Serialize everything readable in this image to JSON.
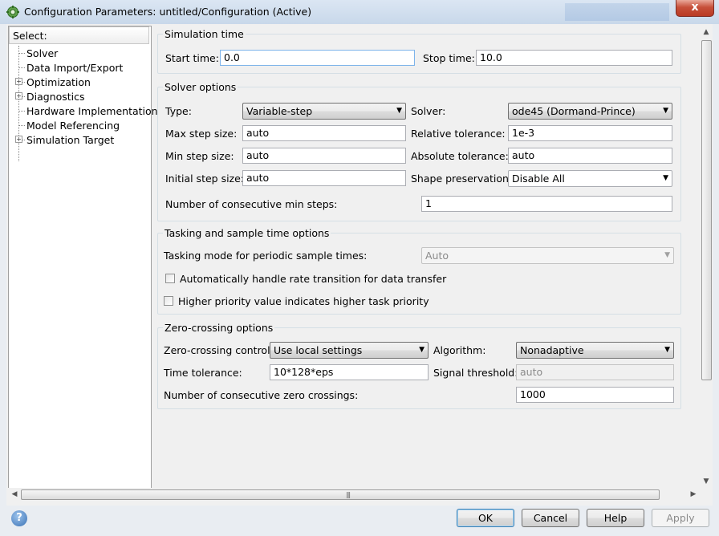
{
  "window": {
    "title": "Configuration Parameters: untitled/Configuration (Active)",
    "close_glyph": "x"
  },
  "tree": {
    "header": "Select:",
    "items": [
      {
        "label": "Solver",
        "expandable": false,
        "selected": true
      },
      {
        "label": "Data Import/Export",
        "expandable": false
      },
      {
        "label": "Optimization",
        "expandable": true
      },
      {
        "label": "Diagnostics",
        "expandable": true
      },
      {
        "label": "Hardware Implementation",
        "expandable": false
      },
      {
        "label": "Model Referencing",
        "expandable": false
      },
      {
        "label": "Simulation Target",
        "expandable": true
      }
    ]
  },
  "simulation_time": {
    "title": "Simulation time",
    "start_label": "Start time:",
    "start_value": "0.0",
    "stop_label": "Stop time:",
    "stop_value": "10.0"
  },
  "solver_options": {
    "title": "Solver options",
    "type_label": "Type:",
    "type_value": "Variable-step",
    "solver_label": "Solver:",
    "solver_value": "ode45 (Dormand-Prince)",
    "max_step_label": "Max step size:",
    "max_step_value": "auto",
    "rel_tol_label": "Relative tolerance:",
    "rel_tol_value": "1e-3",
    "min_step_label": "Min step size:",
    "min_step_value": "auto",
    "abs_tol_label": "Absolute tolerance:",
    "abs_tol_value": "auto",
    "initial_step_label": "Initial step size:",
    "initial_step_value": "auto",
    "shape_label": "Shape preservation:",
    "shape_value": "Disable All",
    "consec_min_label": "Number of consecutive min steps:",
    "consec_min_value": "1"
  },
  "tasking": {
    "title": "Tasking and sample time options",
    "mode_label": "Tasking mode for periodic sample times:",
    "mode_value": "Auto",
    "auto_rate_label": "Automatically handle rate transition for data transfer",
    "auto_rate_checked": false,
    "priority_label": "Higher priority value indicates higher task priority",
    "priority_checked": false
  },
  "zero_crossing": {
    "title": "Zero-crossing options",
    "control_label": "Zero-crossing control:",
    "control_value": "Use local settings",
    "algorithm_label": "Algorithm:",
    "algorithm_value": "Nonadaptive",
    "time_tol_label": "Time tolerance:",
    "time_tol_value": "10*128*eps",
    "signal_label": "Signal threshold:",
    "signal_value": "auto",
    "consec_zc_label": "Number of consecutive zero crossings:",
    "consec_zc_value": "1000"
  },
  "buttons": {
    "help_glyph": "?",
    "ok": "OK",
    "cancel": "Cancel",
    "help": "Help",
    "apply": "Apply"
  },
  "scrollbar_glyphs": {
    "left": "◀",
    "right": "▶",
    "up": "▲",
    "down": "▼",
    "grip_h": "|||",
    "dropdown": "▼"
  }
}
